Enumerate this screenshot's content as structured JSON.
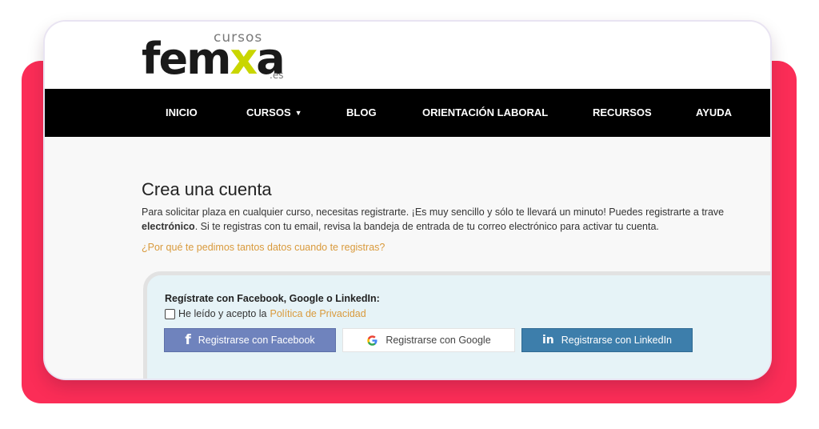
{
  "logo": {
    "cursos": "cursos",
    "brand_pre": "fem",
    "brand_x": "x",
    "brand_post": "a",
    "tld": ".es"
  },
  "nav": {
    "items": [
      {
        "label": "INICIO"
      },
      {
        "label": "CURSOS"
      },
      {
        "label": "BLOG"
      },
      {
        "label": "ORIENTACIÓN LABORAL"
      },
      {
        "label": "RECURSOS"
      },
      {
        "label": "AYUDA"
      }
    ],
    "dropdown_icon": "caret-down-icon"
  },
  "main": {
    "title": "Crea una cuenta",
    "intro_line1": "Para solicitar plaza en cualquier curso, necesitas registrarte. ¡Es muy sencillo y sólo te llevará un minuto! Puedes registrarte a trave",
    "intro_bold": "electrónico",
    "intro_line2": ". Si te registras con tu email, revisa la bandeja de entrada de tu correo electrónico para activar tu cuenta.",
    "why_link": "¿Por qué te pedimos tantos datos cuando te registras?"
  },
  "social": {
    "title": "Regístrate con Facebook, Google o LinkedIn:",
    "privacy_text": "He leído y acepto la",
    "privacy_link": "Política de Privacidad",
    "privacy_checked": false,
    "buttons": {
      "facebook": "Registrarse con Facebook",
      "google": "Registrarse con Google",
      "linkedin": "Registrarse con LinkedIn"
    },
    "icons": {
      "facebook": "facebook-icon",
      "google": "google-icon",
      "linkedin": "linkedin-icon"
    }
  },
  "colors": {
    "backdrop": "#fb2d57",
    "nav_bg": "#000000",
    "link": "#d99a3c",
    "logo_accent": "#c9d600",
    "facebook": "#6f83bd",
    "linkedin": "#3d7eab",
    "social_box_bg": "#e6f3f7"
  }
}
